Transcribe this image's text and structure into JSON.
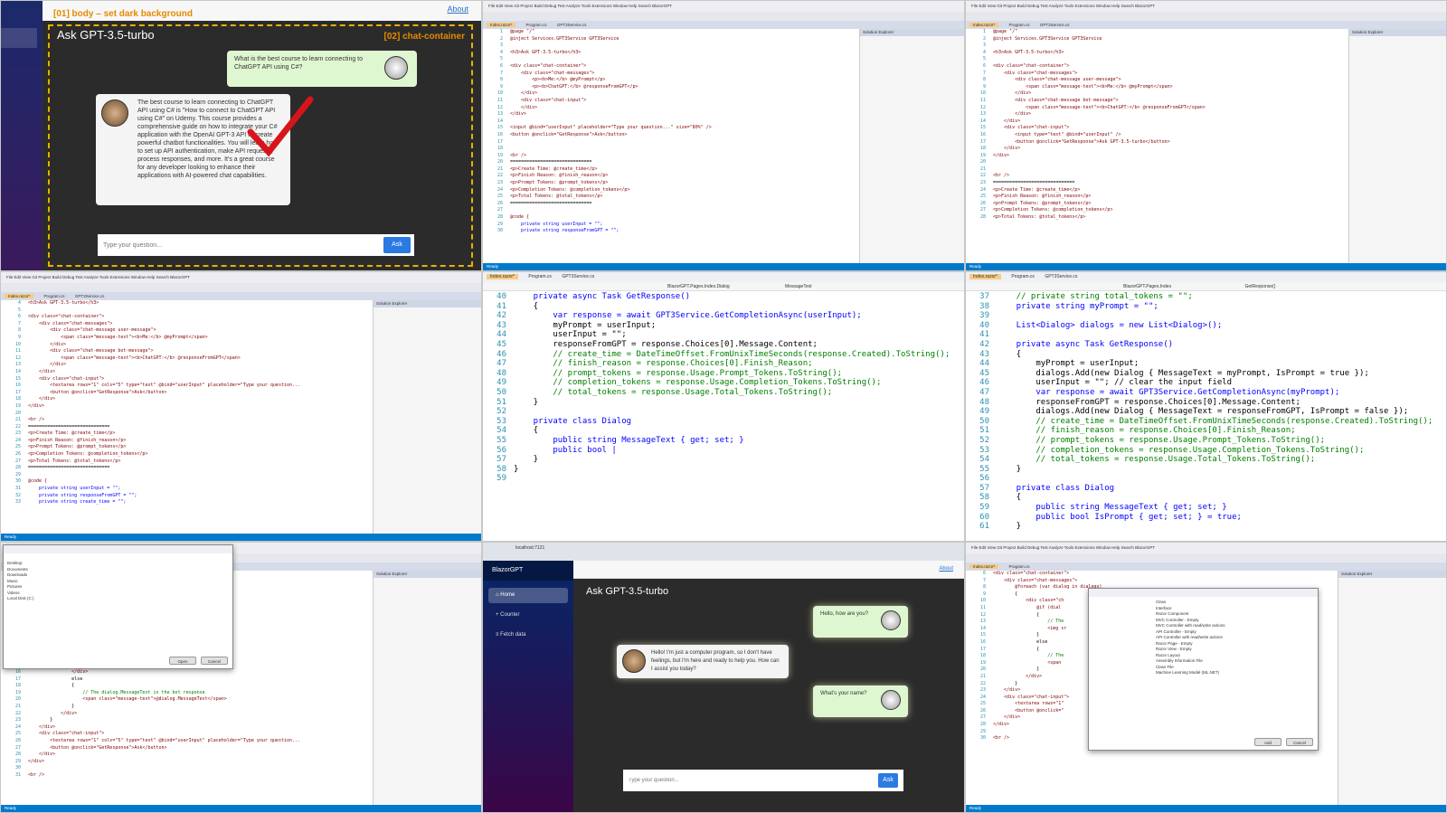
{
  "p1": {
    "annotation_body": "[01] body – set dark background",
    "annotation_container": "[02] chat-container",
    "about": "About",
    "title": "Ask GPT-3.5-turbo",
    "user_message": "What is the best course to learn connecting to ChatGPT API using C#?",
    "bot_message": "The best course to learn connecting to ChatGPT API using C# is \"How to connect to ChatGPT API using C#\" on Udemy. This course provides a comprehensive guide on how to integrate your C# application with the OpenAI GPT-3 API to create powerful chatbot functionalities. You will learn how to set up API authentication, make API requests, process responses, and more. It's a great course for any developer looking to enhance their applications with AI-powered chat capabilities.",
    "input_placeholder": "Type your question...",
    "ask_label": "Ask"
  },
  "ide": {
    "menu": "File  Edit  View  Git  Project  Build  Debug  Test  Analyze  Tools  Extensions  Window  Help   Search   BlazorGPT",
    "tab_index": "Index.razor*",
    "tab_program": "Program.cs",
    "tab_service": "GPT3Service.cs",
    "solution_title": "Solution Explorer",
    "properties_title": "Properties",
    "status_ready": "Ready",
    "status_source": "Add to Source Control",
    "status_repo": "Select Repository"
  },
  "p2": {
    "lines": [
      [
        "1",
        "@page \"/\""
      ],
      [
        "2",
        "@inject Services.GPT3Service GPT3Service"
      ],
      [
        "3",
        ""
      ],
      [
        "4",
        "<h3>Ask GPT-3.5-turbo</h3>"
      ],
      [
        "5",
        ""
      ],
      [
        "6",
        "<div class=\"chat-container\">"
      ],
      [
        "7",
        "    <div class=\"chat-messages\">"
      ],
      [
        "8",
        "        <p><b>Me:</b> @myPrompt</p>"
      ],
      [
        "9",
        "        <p><b>ChatGPT:</b> @responseFromGPT</p>"
      ],
      [
        "10",
        "    </div>"
      ],
      [
        "11",
        "    <div class=\"chat-input\">"
      ],
      [
        "12",
        "    </div>"
      ],
      [
        "13",
        "</div>"
      ],
      [
        "14",
        ""
      ],
      [
        "15",
        "<input @bind=\"userInput\" placeholder=\"Type your question...\" size=\"80%\" />"
      ],
      [
        "16",
        "<button @onclick=\"GetResponse\">Ask</button>"
      ],
      [
        "17",
        ""
      ],
      [
        "18",
        ""
      ],
      [
        "19",
        "<br />"
      ],
      [
        "20",
        "=============================="
      ],
      [
        "21",
        "<p>Create Time: @create_time</p>"
      ],
      [
        "22",
        "<p>Finish Reason: @finish_reason</p>"
      ],
      [
        "23",
        "<p>Prompt Tokens: @prompt_tokens</p>"
      ],
      [
        "24",
        "<p>Completion Tokens: @completion_tokens</p>"
      ],
      [
        "25",
        "<p>Total Tokens: @total_tokens</p>"
      ],
      [
        "26",
        "=============================="
      ],
      [
        "27",
        ""
      ],
      [
        "28",
        "@code {"
      ],
      [
        "29",
        "    private string userInput = \"\";"
      ],
      [
        "30",
        "    private string responseFromGPT = \"\";"
      ]
    ]
  },
  "p3": {
    "lines": [
      [
        "1",
        "@page \"/\""
      ],
      [
        "2",
        "@inject Services.GPT3Service GPT3Service"
      ],
      [
        "3",
        ""
      ],
      [
        "4",
        "<h3>Ask GPT-3.5-turbo</h3>"
      ],
      [
        "5",
        ""
      ],
      [
        "6",
        "<div class=\"chat-container\">"
      ],
      [
        "7",
        "    <div class=\"chat-messages\">"
      ],
      [
        "8",
        "        <div class=\"chat-message user-message\">"
      ],
      [
        "9",
        "            <span class=\"message-text\"><b>Me:</b> @myPrompt</span>"
      ],
      [
        "10",
        "        </div>"
      ],
      [
        "11",
        "        <div class=\"chat-message bot-message\">"
      ],
      [
        "12",
        "            <span class=\"message-text\"><b>ChatGPT:</b> @responseFromGPT</span>"
      ],
      [
        "13",
        "        </div>"
      ],
      [
        "14",
        "    </div>"
      ],
      [
        "15",
        "    <div class=\"chat-input\">"
      ],
      [
        "16",
        "        <input type=\"text\" @bind=\"userInput\" />"
      ],
      [
        "17",
        "        <button @onclick=\"GetResponse\">Ask GPT-3.5-turbo</button>"
      ],
      [
        "18",
        "    </div>"
      ],
      [
        "19",
        "</div>"
      ],
      [
        "20",
        ""
      ],
      [
        "21",
        ""
      ],
      [
        "22",
        "<br />"
      ],
      [
        "23",
        "=============================="
      ],
      [
        "24",
        "<p>Create Time: @create_time</p>"
      ],
      [
        "25",
        "<p>Finish Reason: @finish_reason</p>"
      ],
      [
        "26",
        "<p>Prompt Tokens: @prompt_tokens</p>"
      ],
      [
        "27",
        "<p>Completion Tokens: @completion_tokens</p>"
      ],
      [
        "28",
        "<p>Total Tokens: @total_tokens</p>"
      ]
    ]
  },
  "p4": {
    "lines": [
      [
        "4",
        "<h3>Ask GPT-3.5-turbo</h3>"
      ],
      [
        "5",
        ""
      ],
      [
        "6",
        "<div class=\"chat-container\">"
      ],
      [
        "7",
        "    <div class=\"chat-messages\">"
      ],
      [
        "8",
        "        <div class=\"chat-message user-message\">"
      ],
      [
        "9",
        "            <span class=\"message-text\"><b>Me:</b> @myPrompt</span>"
      ],
      [
        "10",
        "        </div>"
      ],
      [
        "11",
        "        <div class=\"chat-message bot-message\">"
      ],
      [
        "12",
        "            <span class=\"message-text\"><b>ChatGPT:</b> @responseFromGPT</span>"
      ],
      [
        "13",
        "        </div>"
      ],
      [
        "14",
        "    </div>"
      ],
      [
        "15",
        "    <div class=\"chat-input\">"
      ],
      [
        "16",
        "        <textarea rows=\"1\" cols=\"5\" type=\"text\" @bind=\"userInput\" placeholder=\"Type your question..."
      ],
      [
        "17",
        "        <button @onclick=\"GetResponse\">Ask</button>"
      ],
      [
        "18",
        "    </div>"
      ],
      [
        "19",
        "</div>"
      ],
      [
        "20",
        ""
      ],
      [
        "21",
        "<br />"
      ],
      [
        "22",
        "=============================="
      ],
      [
        "23",
        "<p>Create Time: @create_time</p>"
      ],
      [
        "24",
        "<p>Finish Reason: @finish_reason</p>"
      ],
      [
        "25",
        "<p>Prompt Tokens: @prompt_tokens</p>"
      ],
      [
        "26",
        "<p>Completion Tokens: @completion_tokens</p>"
      ],
      [
        "27",
        "<p>Total Tokens: @total_tokens</p>"
      ],
      [
        "28",
        "=============================="
      ],
      [
        "29",
        ""
      ],
      [
        "30",
        "@code {"
      ],
      [
        "31",
        "    private string userInput = \"\";"
      ],
      [
        "32",
        "    private string responseFromGPT = \"\";"
      ],
      [
        "33",
        "    private string create_time = \"\";"
      ]
    ]
  },
  "p5": {
    "tab_index": "Index.razor*",
    "tab_program": "Program.cs",
    "tab_service": "GPT3Service.cs",
    "nav_class": "BlazorGPT.Pages.Index.Dialog",
    "nav_member": "MessageText",
    "lines": [
      [
        "40",
        "    private async Task GetResponse()"
      ],
      [
        "41",
        "    {"
      ],
      [
        "42",
        "        var response = await GPT3Service.GetCompletionAsync(userInput);"
      ],
      [
        "43",
        "        myPrompt = userInput;"
      ],
      [
        "44",
        "        userInput = \"\";"
      ],
      [
        "45",
        "        responseFromGPT = response.Choices[0].Message.Content;"
      ],
      [
        "46",
        "        // create_time = DateTimeOffset.FromUnixTimeSeconds(response.Created).ToString();"
      ],
      [
        "47",
        "        // finish_reason = response.Choices[0].Finish_Reason;"
      ],
      [
        "48",
        "        // prompt_tokens = response.Usage.Prompt_Tokens.ToString();"
      ],
      [
        "49",
        "        // completion_tokens = response.Usage.Completion_Tokens.ToString();"
      ],
      [
        "50",
        "        // total_tokens = response.Usage.Total_Tokens.ToString();"
      ],
      [
        "51",
        "    }"
      ],
      [
        "52",
        ""
      ],
      [
        "53",
        "    private class Dialog"
      ],
      [
        "54",
        "    {"
      ],
      [
        "55",
        "        public string MessageText { get; set; }"
      ],
      [
        "56",
        "        public bool |"
      ],
      [
        "57",
        "    }"
      ],
      [
        "58",
        "}"
      ],
      [
        "59",
        ""
      ]
    ]
  },
  "p6": {
    "tab_index": "Index.razor*",
    "tab_program": "Program.cs",
    "tab_service": "GPT3Service.cs",
    "nav_class": "BlazorGPT.Pages.Index",
    "nav_member": "GetResponse()",
    "lines": [
      [
        "37",
        "    // private string total_tokens = \"\";"
      ],
      [
        "38",
        "    private string myPrompt = \"\";"
      ],
      [
        "39",
        ""
      ],
      [
        "40",
        "    List<Dialog> dialogs = new List<Dialog>();"
      ],
      [
        "41",
        ""
      ],
      [
        "42",
        "    private async Task GetResponse()"
      ],
      [
        "43",
        "    {"
      ],
      [
        "44",
        "        myPrompt = userInput;"
      ],
      [
        "45",
        "        dialogs.Add(new Dialog { MessageText = myPrompt, IsPrompt = true });"
      ],
      [
        "46",
        "        userInput = \"\"; // clear the input field"
      ],
      [
        "47",
        "        var response = await GPT3Service.GetCompletionAsync(myPrompt);"
      ],
      [
        "48",
        "        responseFromGPT = response.Choices[0].Message.Content;"
      ],
      [
        "49",
        "        dialogs.Add(new Dialog { MessageText = responseFromGPT, IsPrompt = false });"
      ],
      [
        "50",
        "        // create_time = DateTimeOffset.FromUnixTimeSeconds(response.Created).ToString();"
      ],
      [
        "51",
        "        // finish_reason = response.Choices[0].Finish_Reason;"
      ],
      [
        "52",
        "        // prompt_tokens = response.Usage.Prompt_Tokens.ToString();"
      ],
      [
        "53",
        "        // completion_tokens = response.Usage.Completion_Tokens.ToString();"
      ],
      [
        "54",
        "        // total_tokens = response.Usage.Total_Tokens.ToString();"
      ],
      [
        "55",
        "    }"
      ],
      [
        "56",
        ""
      ],
      [
        "57",
        "    private class Dialog"
      ],
      [
        "58",
        "    {"
      ],
      [
        "59",
        "        public string MessageText { get; set; }"
      ],
      [
        "60",
        "        public bool IsPrompt { get; set; } = true;"
      ],
      [
        "61",
        "    }"
      ]
    ]
  },
  "p7": {
    "lines": [
      [
        "16",
        "                </div>"
      ],
      [
        "17",
        "                else"
      ],
      [
        "18",
        "                {"
      ],
      [
        "19",
        "                    // The dialog.MessageText is the bot response"
      ],
      [
        "20",
        "                    <span class=\"message-text\">@dialog.MessageText</span>"
      ],
      [
        "21",
        "                }"
      ],
      [
        "22",
        "            </div>"
      ],
      [
        "23",
        "        }"
      ],
      [
        "24",
        "    </div>"
      ],
      [
        "25",
        "    <div class=\"chat-input\">"
      ],
      [
        "26",
        "        <textarea rows=\"1\" cols=\"5\" type=\"text\" @bind=\"userInput\" placeholder=\"Type your question..."
      ],
      [
        "27",
        "        <button @onclick=\"GetResponse\">Ask</button>"
      ],
      [
        "28",
        "    </div>"
      ],
      [
        "29",
        "</div>"
      ],
      [
        "30",
        ""
      ],
      [
        "31",
        "<br />"
      ]
    ],
    "dialog_rows": [
      "Desktop",
      "Documents",
      "Downloads",
      "Music",
      "Pictures",
      "Videos",
      "Local Disk (C:)"
    ],
    "dialog_open": "Open",
    "dialog_cancel": "Cancel"
  },
  "p8": {
    "url": "localhost:7121",
    "brand": "BlazorGPT",
    "nav": [
      "Home",
      "Counter",
      "Fetch data"
    ],
    "about": "About",
    "title": "Ask GPT-3.5-turbo",
    "user1": "Hello, how are you?",
    "bot1": "Hello! I'm just a computer program, so I don't have feelings, but I'm here and ready to help you. How can I assist you today?",
    "user2": "What's your name?",
    "input_placeholder": "Type your question...",
    "ask_label": "Ask"
  },
  "p9": {
    "lines": [
      [
        "6",
        "<div class=\"chat-container\">"
      ],
      [
        "7",
        "    <div class=\"chat-messages\">"
      ],
      [
        "8",
        "        @foreach (var dialog in dialogs)"
      ],
      [
        "9",
        "        {"
      ],
      [
        "10",
        "            <div class=\"ch"
      ],
      [
        "11",
        "                @if (dial"
      ],
      [
        "12",
        "                {"
      ],
      [
        "13",
        "                    // The"
      ],
      [
        "14",
        "                    <img sr"
      ],
      [
        "15",
        "                }"
      ],
      [
        "16",
        "                else"
      ],
      [
        "17",
        "                {"
      ],
      [
        "18",
        "                    // The"
      ],
      [
        "19",
        "                    <span"
      ],
      [
        "20",
        "                }"
      ],
      [
        "21",
        "            </div>"
      ],
      [
        "22",
        "        }"
      ],
      [
        "23",
        "    </div>"
      ],
      [
        "24",
        "    <div class=\"chat-input\">"
      ],
      [
        "25",
        "        <textarea rows=\"1\""
      ],
      [
        "26",
        "        <button @onclick=\""
      ],
      [
        "27",
        "    </div>"
      ],
      [
        "28",
        "</div>"
      ],
      [
        "29",
        ""
      ],
      [
        "30",
        "<br />"
      ]
    ],
    "dialog_items": [
      "Class",
      "Interface",
      "Razor Component",
      "MVC Controller - Empty",
      "MVC Controller with read/write actions",
      "API Controller - Empty",
      "API Controller with read/write actions",
      "Razor Page - Empty",
      "Razor View - Empty",
      "Razor Layout",
      "Assembly Information File",
      "Class File",
      "Machine Learning Model (ML.NET)"
    ],
    "dialog_add": "Add",
    "dialog_cancel": "Cancel"
  }
}
